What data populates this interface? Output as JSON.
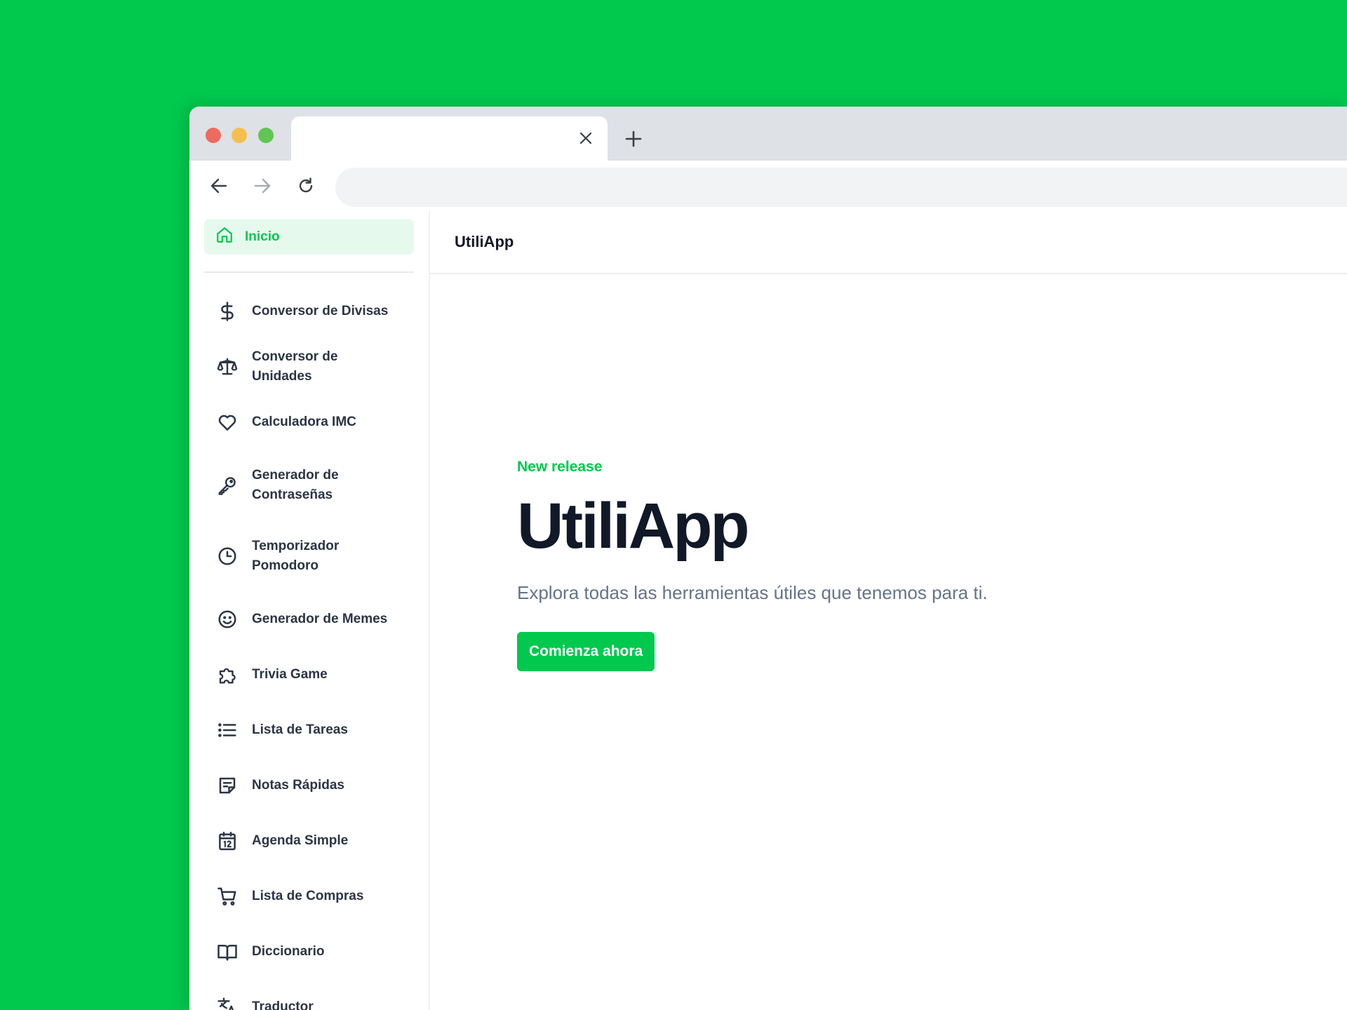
{
  "browser": {
    "tab_title": "",
    "address": ""
  },
  "sidebar": {
    "home": {
      "label": "Inicio",
      "icon": "home-icon"
    },
    "items": [
      {
        "label": "Conversor de Divisas",
        "icon": "dollar-icon"
      },
      {
        "label": "Conversor de Unidades",
        "icon": "scale-icon"
      },
      {
        "label": "Calculadora IMC",
        "icon": "heart-icon"
      },
      {
        "label": "Generador de Contraseñas",
        "icon": "key-icon"
      },
      {
        "label": "Temporizador Pomodoro",
        "icon": "clock-icon"
      },
      {
        "label": "Generador de Memes",
        "icon": "smiley-icon"
      },
      {
        "label": "Trivia Game",
        "icon": "puzzle-icon"
      },
      {
        "label": "Lista de Tareas",
        "icon": "list-icon"
      },
      {
        "label": "Notas Rápidas",
        "icon": "note-icon"
      },
      {
        "label": "Agenda Simple",
        "icon": "calendar-icon"
      },
      {
        "label": "Lista de Compras",
        "icon": "cart-icon"
      },
      {
        "label": "Diccionario",
        "icon": "book-icon"
      },
      {
        "label": "Traductor",
        "icon": "translate-icon"
      }
    ]
  },
  "header": {
    "title": "UtiliApp"
  },
  "hero": {
    "eyebrow": "New release",
    "headline": "UtiliApp",
    "lead": "Explora todas las herramientas útiles que tenemos para ti.",
    "cta_label": "Comienza ahora"
  },
  "colors": {
    "brand_green": "#00c94e",
    "text_dark": "#111827",
    "text_muted": "#64748b",
    "sidebar_text": "#2b3544"
  }
}
